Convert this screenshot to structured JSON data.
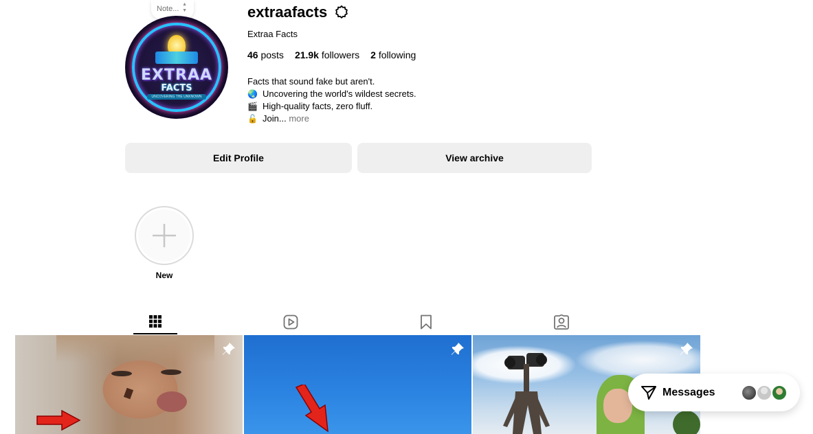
{
  "note": {
    "placeholder": "Note..."
  },
  "profile": {
    "username": "extraafacts",
    "full_name": "Extraa Facts",
    "avatar_text": {
      "line1": "EXTRAA",
      "line2": "FACTS",
      "line3": "UNCOVERING THE UNKNOWN"
    },
    "stats": {
      "posts_count": "46",
      "posts_label": "posts",
      "followers_count": "21.9k",
      "followers_label": "followers",
      "following_count": "2",
      "following_label": "following"
    },
    "bio": [
      {
        "emoji": "",
        "text": "Facts that sound fake but aren't."
      },
      {
        "emoji": "🌏",
        "text": "Uncovering the world's wildest secrets."
      },
      {
        "emoji": "🎬",
        "text": "High-quality facts, zero fluff."
      },
      {
        "emoji": "🔓",
        "text": "Join..."
      }
    ],
    "bio_more": "more"
  },
  "buttons": {
    "edit_profile": "Edit Profile",
    "view_archive": "View archive"
  },
  "highlights": {
    "new_label": "New"
  },
  "tabs": [
    {
      "icon": "grid-icon",
      "active": true
    },
    {
      "icon": "reels-icon",
      "active": false
    },
    {
      "icon": "saved-icon",
      "active": false
    },
    {
      "icon": "tagged-icon",
      "active": false
    }
  ],
  "posts": [
    {
      "pinned": true,
      "icon": "pin-icon"
    },
    {
      "pinned": true,
      "icon": "pin-icon"
    },
    {
      "pinned": true,
      "icon": "pin-icon"
    }
  ],
  "messages": {
    "label": "Messages"
  },
  "colors": {
    "button_bg": "#efefef",
    "muted_text": "#737373",
    "arrow_red": "#e3241b"
  }
}
